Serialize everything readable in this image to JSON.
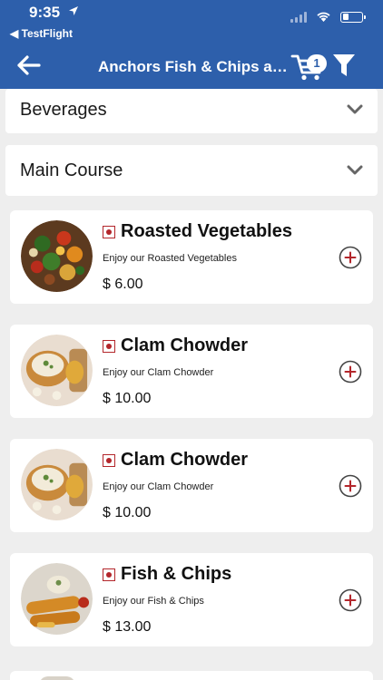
{
  "status_bar": {
    "time": "9:35",
    "back_to_app": "◀ TestFlight"
  },
  "nav": {
    "title": "Anchors Fish & Chips and...",
    "cart_count": "1"
  },
  "categories": [
    {
      "label": "Beverages"
    },
    {
      "label": "Main Course"
    }
  ],
  "items": [
    {
      "name": "Roasted Vegetables",
      "description": "Enjoy our Roasted Vegetables",
      "price": "$ 6.00"
    },
    {
      "name": "Clam Chowder",
      "description": "Enjoy our Clam Chowder",
      "price": "$ 10.00"
    },
    {
      "name": "Clam Chowder",
      "description": "Enjoy our Clam Chowder",
      "price": "$ 10.00"
    },
    {
      "name": "Fish & Chips",
      "description": "Enjoy our Fish & Chips",
      "price": "$ 13.00"
    }
  ],
  "colors": {
    "header": "#2d5fab",
    "veg_mark": "#b3262b",
    "add_button": "#b3262b",
    "background": "#eeeeee"
  },
  "icons": [
    "back-arrow-icon",
    "cart-icon",
    "filter-icon",
    "chevron-down-icon",
    "plus-circle-icon",
    "veg-mark-icon"
  ]
}
